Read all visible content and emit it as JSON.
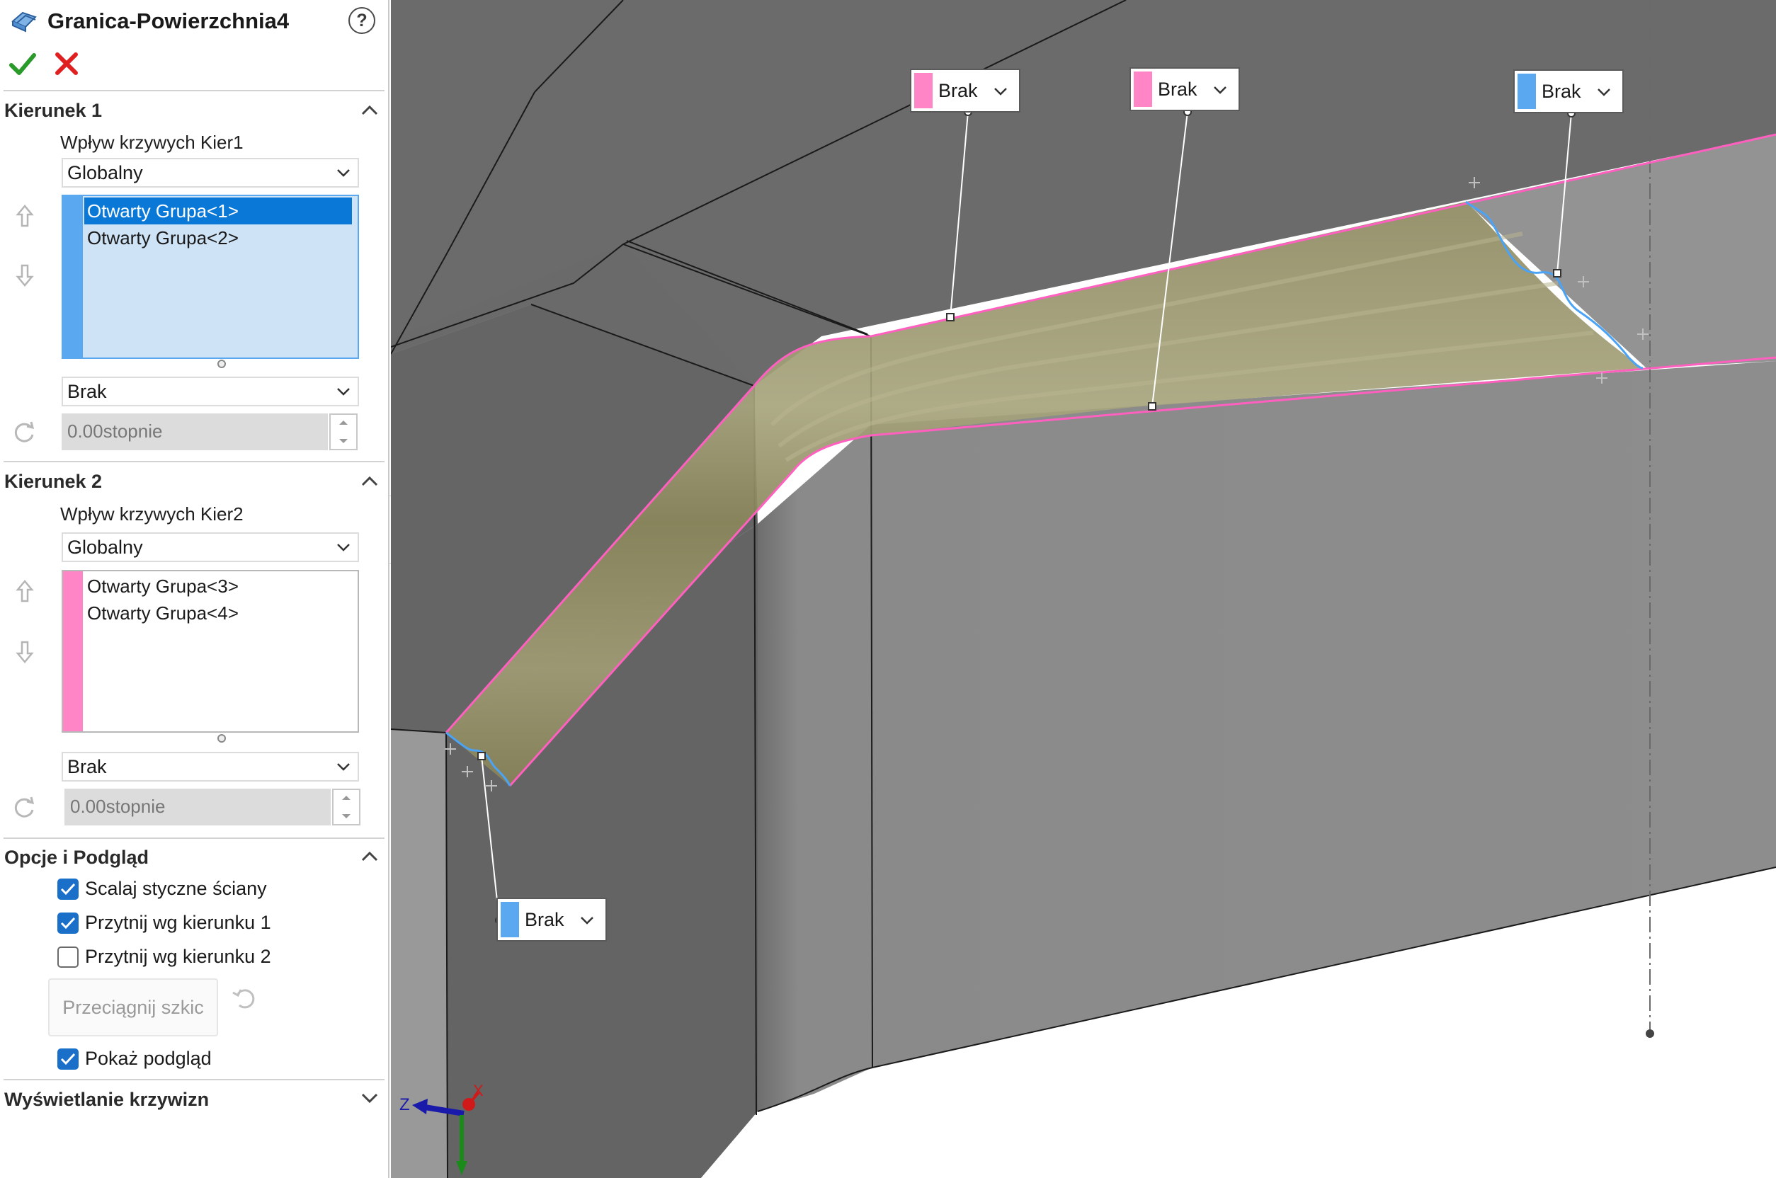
{
  "feature": {
    "title": "Granica-Powierzchnia4",
    "help_label": "?"
  },
  "direction1": {
    "title": "Kierunek 1",
    "influence_label": "Wpływ krzywych Kier1",
    "influence_value": "Globalny",
    "items": [
      "Otwarty Grupa<1>",
      "Otwarty Grupa<2>"
    ],
    "selected_index": 0,
    "list_color": "#5aa9f0",
    "tangency_value": "Brak",
    "angle_value": "0.00stopnie"
  },
  "direction2": {
    "title": "Kierunek 2",
    "influence_label": "Wpływ krzywych Kier2",
    "influence_value": "Globalny",
    "items": [
      "Otwarty Grupa<3>",
      "Otwarty Grupa<4>"
    ],
    "list_color": "#ff85c6",
    "tangency_value": "Brak",
    "angle_value": "0.00stopnie"
  },
  "options": {
    "title": "Opcje i Podgląd",
    "merge_tangent_faces": {
      "label": "Scalaj styczne ściany",
      "checked": true
    },
    "trim_dir1": {
      "label": "Przytnij wg kierunku 1",
      "checked": true
    },
    "trim_dir2": {
      "label": "Przytnij wg kierunku 2",
      "checked": false
    },
    "drag_sketch_label": "Przeciągnij szkic",
    "show_preview": {
      "label": "Pokaż podgląd",
      "checked": true
    }
  },
  "curvature_display": {
    "title": "Wyświetlanie krzywizn"
  },
  "callouts": [
    {
      "id": "pink-1",
      "label": "Brak",
      "color": "#ff85c6"
    },
    {
      "id": "pink-2",
      "label": "Brak",
      "color": "#ff85c6"
    },
    {
      "id": "blue-1",
      "label": "Brak",
      "color": "#5aa9f0"
    },
    {
      "id": "blue-2",
      "label": "Brak",
      "color": "#5aa9f0"
    }
  ],
  "triad": {
    "z_label": "Z",
    "x_label": "X"
  },
  "colors": {
    "selection_blue": "#0a78d7",
    "list_bg_selected": "#cfe3f7",
    "surface_preview": "#8f8a5c",
    "boundary_pink": "#ff5fbf",
    "ok_green": "#2a9a2a",
    "cancel_red": "#e02020"
  }
}
